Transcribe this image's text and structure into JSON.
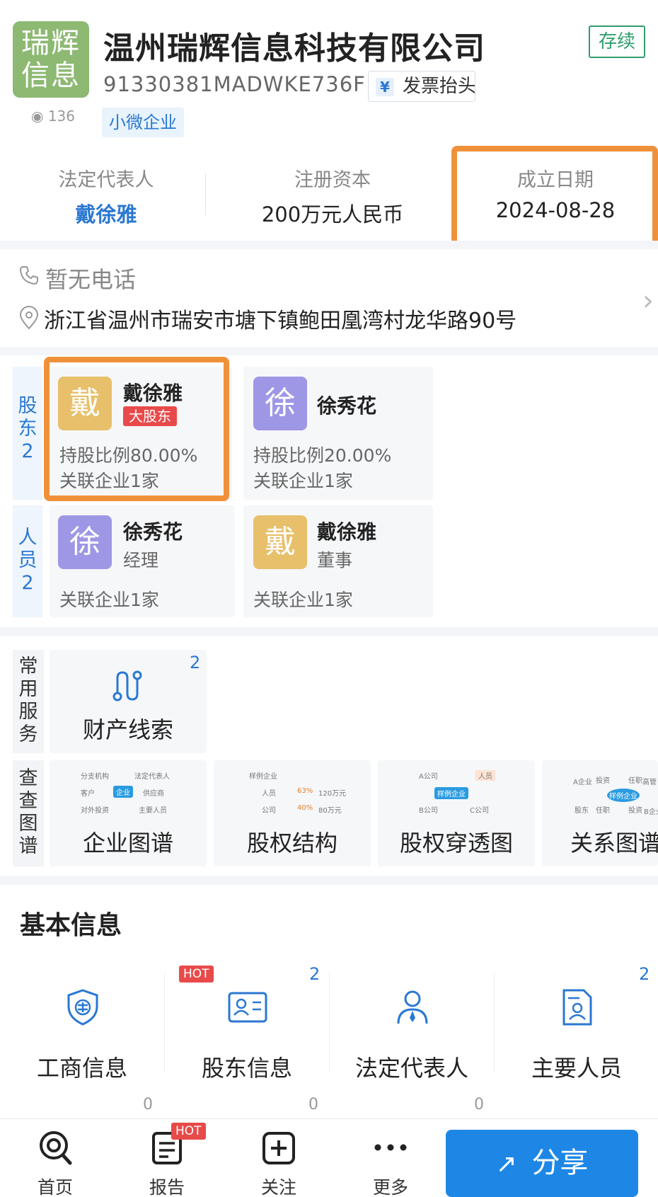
{
  "company": {
    "logo_text_line1": "瑞辉",
    "logo_text_line2": "信息",
    "name": "温州瑞辉信息科技有限公司",
    "status": "存续",
    "credit_code": "91330381MADWKE736F",
    "invoice_label": "发票抬头",
    "view_count": "136",
    "scale_tag": "小微企业"
  },
  "key_info": [
    {
      "label": "法定代表人",
      "value": "戴徐雅"
    },
    {
      "label": "注册资本",
      "value": "200万元人民币"
    },
    {
      "label": "成立日期",
      "value": "2024-08-28"
    }
  ],
  "contact": {
    "phone": "暂无电话",
    "address": "浙江省温州市瑞安市塘下镇鲍田凰湾村龙华路90号"
  },
  "shareholders": {
    "side_label": "股东",
    "count": "2",
    "items": [
      {
        "avatar": "戴",
        "name": "戴徐雅",
        "tag": "大股东",
        "ratio": "持股比例80.00%",
        "related": "关联企业1家"
      },
      {
        "avatar": "徐",
        "name": "徐秀花",
        "ratio": "持股比例20.00%",
        "related": "关联企业1家"
      }
    ]
  },
  "personnel": {
    "side_label": "人员",
    "count": "2",
    "items": [
      {
        "avatar": "徐",
        "name": "徐秀花",
        "role": "经理",
        "related": "关联企业1家"
      },
      {
        "avatar": "戴",
        "name": "戴徐雅",
        "role": "董事",
        "related": "关联企业1家"
      }
    ]
  },
  "common_services": {
    "side_label": "常用服务",
    "items": [
      {
        "label": "财产线索",
        "count": "2"
      }
    ]
  },
  "graphs": {
    "side_label": "查查图谱",
    "items": [
      {
        "label": "企业图谱",
        "mini": [
          "分支机构",
          "法定代表人",
          "客户",
          "企业",
          "供应商",
          "对外投资",
          "主要人员"
        ]
      },
      {
        "label": "股权结构",
        "mini": [
          "样例企业",
          "人员",
          "63%",
          "120万元",
          "公司",
          "40%",
          "80万元"
        ]
      },
      {
        "label": "股权穿透图",
        "mini": [
          "A公司",
          "人员",
          "样例企业",
          "B公司",
          "C公司"
        ]
      },
      {
        "label": "关系图谱",
        "mini": [
          "A企业",
          "投资",
          "任职",
          "高管",
          "样例企业",
          "股东",
          "任职",
          "投资",
          "B企业"
        ]
      }
    ]
  },
  "basic_info": {
    "title": "基本信息",
    "hot_label": "HOT",
    "items": [
      {
        "label": "工商信息",
        "count": ""
      },
      {
        "label": "股东信息",
        "count": "2"
      },
      {
        "label": "法定代表人",
        "count": ""
      },
      {
        "label": "主要人员",
        "count": "2"
      }
    ],
    "next_row_counts": [
      "0",
      "0",
      "0"
    ]
  },
  "bottom_nav": {
    "items": [
      {
        "label": "首页",
        "icon": "home-search-icon"
      },
      {
        "label": "报告",
        "icon": "report-icon",
        "badge": "HOT"
      },
      {
        "label": "关注",
        "icon": "follow-plus-icon"
      },
      {
        "label": "更多",
        "icon": "more-dots-icon"
      }
    ],
    "cta_label": "分享"
  },
  "colors": {
    "accent": "#2a78d2",
    "highlight": "#f0913a",
    "status_green": "#2f9d6c",
    "hot_red": "#e84a4a"
  }
}
